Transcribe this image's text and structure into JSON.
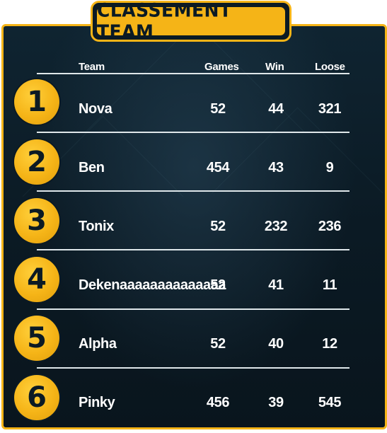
{
  "title": "CLASSEMENT TEAM",
  "columns": {
    "team": "Team",
    "games": "Games",
    "win": "Win",
    "loose": "Loose"
  },
  "rows": [
    {
      "rank": "1",
      "team": "Nova",
      "games": "52",
      "win": "44",
      "loose": "321"
    },
    {
      "rank": "2",
      "team": "Ben",
      "games": "454",
      "win": "43",
      "loose": "9"
    },
    {
      "rank": "3",
      "team": "Tonix",
      "games": "52",
      "win": "232",
      "loose": "236"
    },
    {
      "rank": "4",
      "team": "Dekenaaaaaaaaaaaaaa",
      "games": "52",
      "win": "41",
      "loose": "11"
    },
    {
      "rank": "5",
      "team": "Alpha",
      "games": "52",
      "win": "40",
      "loose": "12"
    },
    {
      "rank": "6",
      "team": "Pinky",
      "games": "456",
      "win": "39",
      "loose": "545"
    }
  ],
  "colors": {
    "accent": "#f5b417",
    "background": "#0b1a24",
    "text": "#ffffff"
  }
}
